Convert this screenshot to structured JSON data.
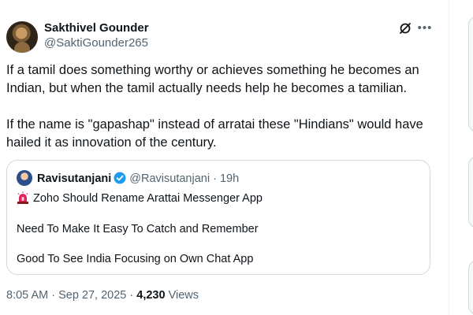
{
  "tweet": {
    "author": {
      "name": "Sakthivel Gounder",
      "handle": "@SaktiGounder265"
    },
    "paragraphs": [
      "If a tamil does something worthy or achieves something he becomes an Indian, but when the tamil actually needs help he becomes a tamilian.",
      "If the name is \"gapashap\" instead of arratai these \"Hindians\" would have hailed it as innovation of the century."
    ],
    "quote": {
      "author_name": "Ravisutanjani",
      "author_handle": "@Ravisutanjani",
      "separator": "·",
      "time": "19h",
      "lines": [
        "Zoho Should Rename Arattai Messenger App",
        "Need To Make It Easy To Catch and Remember",
        "Good To See India Focusing on Own Chat App"
      ]
    },
    "footer": {
      "timestamp": "8:05 AM · Sep 27, 2025 · ",
      "views_count": "4,230",
      "views_label": " Views"
    }
  },
  "icons": {
    "grok": "grok-icon",
    "more": "more-options-icon",
    "verified": "verified-badge-icon",
    "siren": "police-siren-icon"
  },
  "colors": {
    "text_primary": "#0f1419",
    "text_secondary": "#536471",
    "verified_blue": "#1d9bf0",
    "border": "#cfd9de"
  }
}
